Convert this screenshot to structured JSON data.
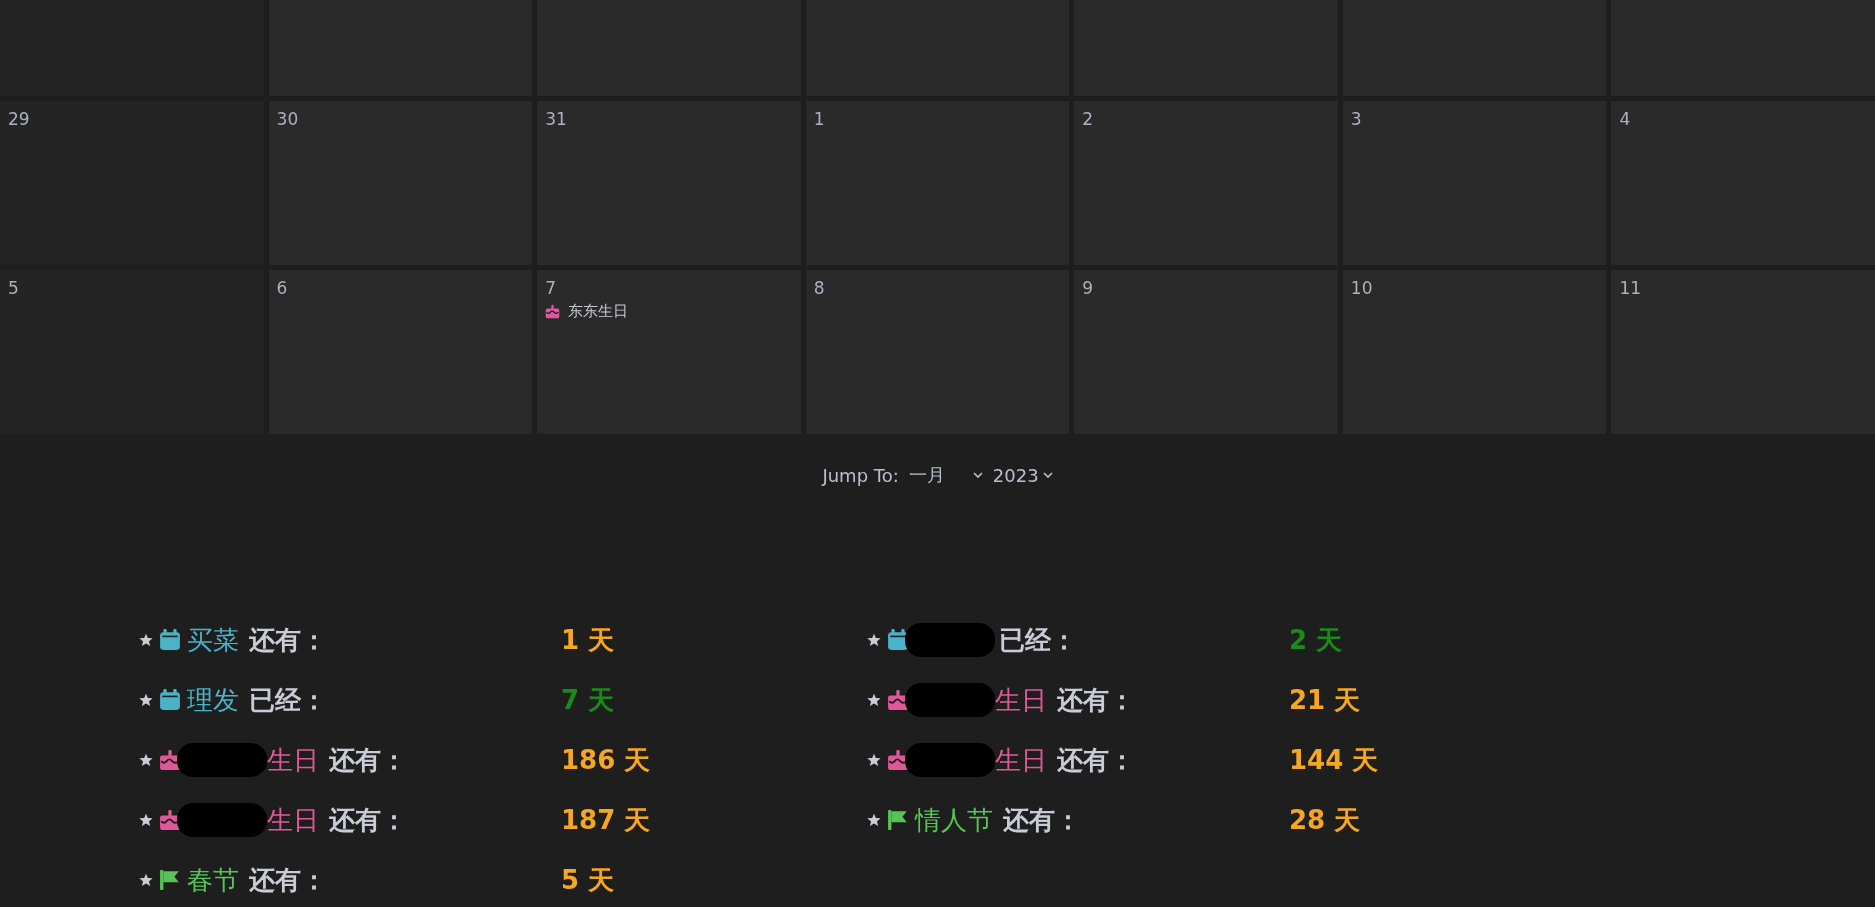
{
  "calendar": {
    "weeks": [
      {
        "kind": "hidden"
      },
      {
        "kind": "dated",
        "days": [
          {
            "date": "29"
          },
          {
            "date": "30"
          },
          {
            "date": "31"
          },
          {
            "date": "1"
          },
          {
            "date": "2"
          },
          {
            "date": "3"
          },
          {
            "date": "4"
          }
        ]
      },
      {
        "kind": "dated",
        "days": [
          {
            "date": "5"
          },
          {
            "date": "6"
          },
          {
            "date": "7",
            "events": [
              {
                "kind": "birthday",
                "title": "东东生日"
              }
            ]
          },
          {
            "date": "8"
          },
          {
            "date": "9"
          },
          {
            "date": "10"
          },
          {
            "date": "11"
          }
        ]
      }
    ]
  },
  "jump_to": {
    "label": "Jump To:",
    "month": "一月",
    "year": "2023"
  },
  "countdowns": [
    {
      "kind": "todo",
      "redacted": false,
      "name": "买菜",
      "status": "还有：",
      "days": "1 天",
      "past": false
    },
    {
      "kind": "todo",
      "redacted": false,
      "name": "理发",
      "status": "已经：",
      "days": "7 天",
      "past": true
    },
    {
      "kind": "birthday",
      "redacted": true,
      "name": "生日",
      "status": "还有：",
      "days": "186 天",
      "past": false
    },
    {
      "kind": "birthday",
      "redacted": true,
      "name": "生日",
      "status": "还有：",
      "days": "187 天",
      "past": false
    },
    {
      "kind": "holiday",
      "redacted": false,
      "name": "春节",
      "status": "还有：",
      "days": "5 天",
      "past": false
    },
    {
      "kind": "todo",
      "redacted": true,
      "status": "已经：",
      "days": "2 天",
      "past": true
    },
    {
      "kind": "birthday",
      "redacted": true,
      "name": "生日",
      "status": "还有：",
      "days": "21 天",
      "past": false
    },
    {
      "kind": "birthday",
      "redacted": true,
      "name": "生日",
      "status": "还有：",
      "days": "144 天",
      "past": false
    },
    {
      "kind": "holiday",
      "redacted": false,
      "name": "情人节",
      "status": "还有：",
      "days": "28 天",
      "past": false
    }
  ]
}
